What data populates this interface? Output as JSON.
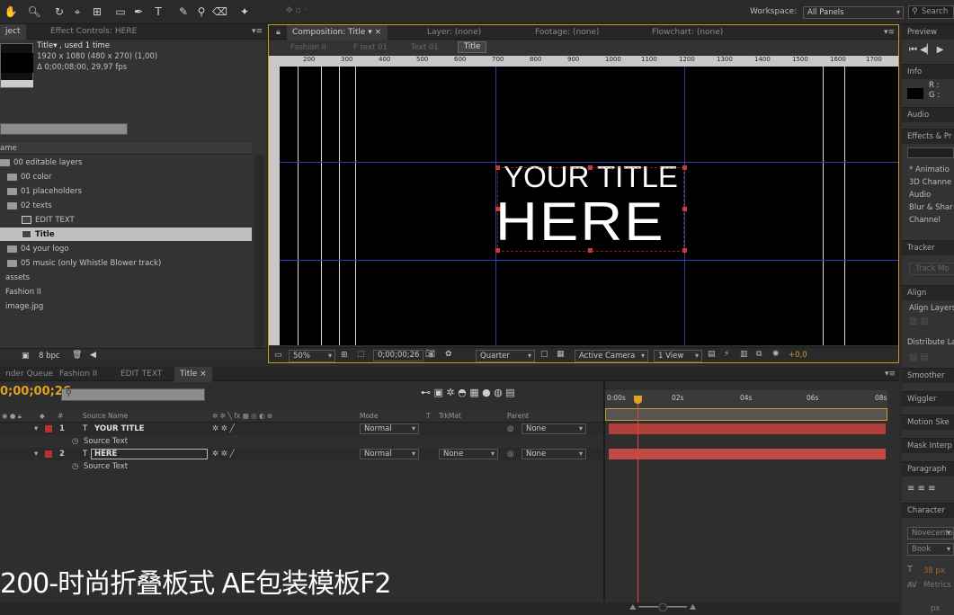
{
  "toolbar": {
    "workspace_label": "Workspace:",
    "workspace_value": "All Panels",
    "search_placeholder": "Search"
  },
  "project_panel": {
    "tab_project": "ject",
    "tab_effect_controls": "Effect Controls: HERE",
    "comp_name": "Title▾ , used 1 time",
    "comp_res": "1920 x 1080  (480 x 270) (1,00)",
    "comp_dur": "Δ 0;00;08;00, 29,97 fps",
    "col_name": "ame",
    "items": [
      {
        "label": "00 editable layers",
        "kind": "folder"
      },
      {
        "label": "00 color",
        "kind": "folder"
      },
      {
        "label": "01 placeholders",
        "kind": "folder"
      },
      {
        "label": "02 texts",
        "kind": "folder"
      },
      {
        "label": "EDIT TEXT",
        "kind": "comp"
      },
      {
        "label": "Title",
        "kind": "comp"
      },
      {
        "label": "04 your logo",
        "kind": "folder"
      },
      {
        "label": "05 music (only Whistle Blower track)",
        "kind": "folder"
      },
      {
        "label": "assets",
        "kind": "plain"
      },
      {
        "label": "Fashion II",
        "kind": "plain"
      },
      {
        "label": "image.jpg",
        "kind": "plain"
      }
    ],
    "bpc": "8 bpc"
  },
  "comp_panel": {
    "tab_comp": "Composition: Title",
    "tab_layer": "Layer: (none)",
    "tab_footage": "Footage: (none)",
    "tab_flowchart": "Flowchart: (none)",
    "crumbs": [
      "Fashion II",
      "F text 01",
      "Text 01",
      "Title"
    ],
    "ruler": [
      "200",
      "300",
      "400",
      "500",
      "600",
      "700",
      "800",
      "900",
      "1000",
      "1100",
      "1200",
      "1300",
      "1400",
      "1500",
      "1600",
      "1700"
    ],
    "title_line1": "YOUR TITLE",
    "title_line2": "HERE",
    "zoom": "50%",
    "timecode": "0;00;00;26",
    "resolution": "Quarter",
    "camera": "Active Camera",
    "view": "1 View",
    "exposure": "+0,0"
  },
  "right_panels": {
    "preview": "Preview",
    "info": "Info",
    "info_r": "R :",
    "info_g": "G :",
    "audio": "Audio",
    "effects": "Effects & Pr",
    "effects_items": [
      "* Animatio",
      "3D Channe",
      "Audio",
      "Blur & Shar",
      "Channel"
    ],
    "tracker": "Tracker",
    "track_motion": "Track Mo",
    "align": "Align",
    "align_layers": "Align Layers",
    "distribute": "Distribute La",
    "smoother": "Smoother",
    "wiggler": "Wiggler",
    "motion_sketch": "Motion Ske",
    "mask_interp": "Mask Interp",
    "paragraph": "Paragraph",
    "character": "Character",
    "font": "Novecento",
    "font_style": "Book",
    "font_size": "38 px",
    "metrics": "Metrics",
    "px": "px"
  },
  "timeline": {
    "tabs": [
      "nder Queue",
      "Fashion II",
      "EDIT TEXT",
      "Title"
    ],
    "timecode": "0;00;00;26",
    "col_source": "Source Name",
    "col_mode": "Mode",
    "col_t": "T",
    "col_trkmat": "TrkMat",
    "col_parent": "Parent",
    "ticks": [
      "0:00s",
      "02s",
      "04s",
      "06s",
      "08s"
    ],
    "layers": [
      {
        "num": "1",
        "name": "YOUR TITLE",
        "mode": "Normal",
        "trkmat": "",
        "parent": "None",
        "sub": "Source Text"
      },
      {
        "num": "2",
        "name": "HERE",
        "mode": "Normal",
        "trkmat": "None",
        "parent": "None",
        "sub": "Source Text"
      }
    ]
  },
  "overlay_caption": "200-时尚折叠板式 AE包装模板F2"
}
